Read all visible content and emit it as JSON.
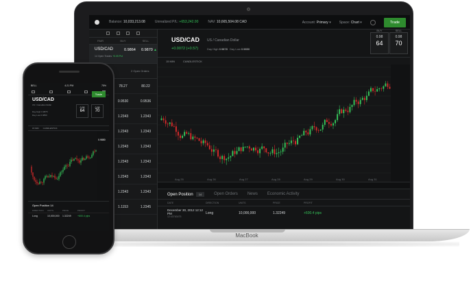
{
  "laptop": {
    "brand": "MacBook",
    "topbar": {
      "balance_label": "Balance:",
      "balance_value": "10,033,213.08",
      "upl_label": "Unrealized P/L:",
      "upl_value": "+653,242.00",
      "nav_label": "NAV:",
      "nav_value": "10,665,504.08 CAD",
      "account_label": "Account:",
      "account_value": "Primary",
      "space_label": "Space:",
      "space_value": "Chart",
      "trade_label": "Trade"
    },
    "watchlist": {
      "headers": [
        "PAIR",
        "BUY",
        "SELL"
      ],
      "active": {
        "pair": "USD/CAD",
        "buy": "0.9864",
        "sell": "0.9870",
        "sub": "14 Open Trades",
        "change": "+0.05 Pct"
      },
      "mini": {
        "buy": "1.2343",
        "sell": "1.2343",
        "left_sub": "0.5 Pct",
        "right_sub": "2 Open Orders"
      },
      "rows": [
        {
          "buy": "78.27",
          "sell": "80.22"
        },
        {
          "buy": "0.9530",
          "sell": "0.9536"
        },
        {
          "buy": "1.2343",
          "sell": "1.2343"
        },
        {
          "buy": "1.2343",
          "sell": "1.2343"
        },
        {
          "buy": "1.2343",
          "sell": "1.2343"
        },
        {
          "buy": "1.2343",
          "sell": "1.2343"
        },
        {
          "buy": "1.2343",
          "sell": "1.2343"
        },
        {
          "buy": "1.2343",
          "sell": "1.2343"
        },
        {
          "buy": "1.1153",
          "sell": "1.2345"
        }
      ]
    },
    "header": {
      "pair": "USD/CAD",
      "name": "US / Canadian Dollar",
      "change": "+0.0072 (+0.57)",
      "day_high_label": "Day High",
      "day_high": "0.9878",
      "day_low_label": "Day Low",
      "day_low": "0.9850",
      "buy": {
        "label": "BUY",
        "small": "0.98",
        "big": "64"
      },
      "sell": {
        "label": "SELL",
        "small": "0.98",
        "big": "70"
      }
    },
    "chart_toolbar": {
      "interval": "15 MIN",
      "type": "CANDLESTICK"
    },
    "chart_x_labels": [
      "Aug 25",
      "Aug 26",
      "Aug 27",
      "Aug 28",
      "Aug 29",
      "Aug 30",
      "Aug 31"
    ],
    "positions": {
      "tabs": [
        "Open Position",
        "Open Orders",
        "News",
        "Economic Activity"
      ],
      "count": "14",
      "headers": [
        "DATE",
        "DIRECTION",
        "UNITS",
        "PRICE",
        "PROFIT"
      ],
      "row": {
        "date": "December 30, 2012  12:12 PM",
        "date_sub": "12:43763475",
        "direction": "Long",
        "units": "10,000,000",
        "price": "1.32249",
        "profit": "+600.4 pips"
      }
    }
  },
  "phone": {
    "status": {
      "carrier": "BELL",
      "time": "4:21 PM",
      "battery": "75%"
    },
    "pair": "USD/CAD",
    "name": "US / Canadian Dollar",
    "trade_label": "Trade",
    "day_high_label": "Day High",
    "day_high": "0.9878",
    "day_low_label": "Day Low",
    "day_low": "0.9850",
    "buy": {
      "small": "0.98",
      "big": "64"
    },
    "sell": {
      "small": "0.98",
      "big": "70"
    },
    "toolbar": {
      "interval": "15 MIN",
      "type": "CANDLESTICK"
    },
    "price_tag": "0.9880",
    "positions": {
      "tab": "Open Position",
      "count": "14",
      "headers": [
        "DIRECTION",
        "UNITS",
        "PRICE",
        "PROFIT"
      ],
      "row": {
        "direction": "Long",
        "units": "10,000,000",
        "price": "1.32249",
        "profit": "+600.4 pips"
      }
    }
  },
  "colors": {
    "up": "#36c45a",
    "down": "#d42a2a",
    "accent": "#2e8b2e"
  }
}
